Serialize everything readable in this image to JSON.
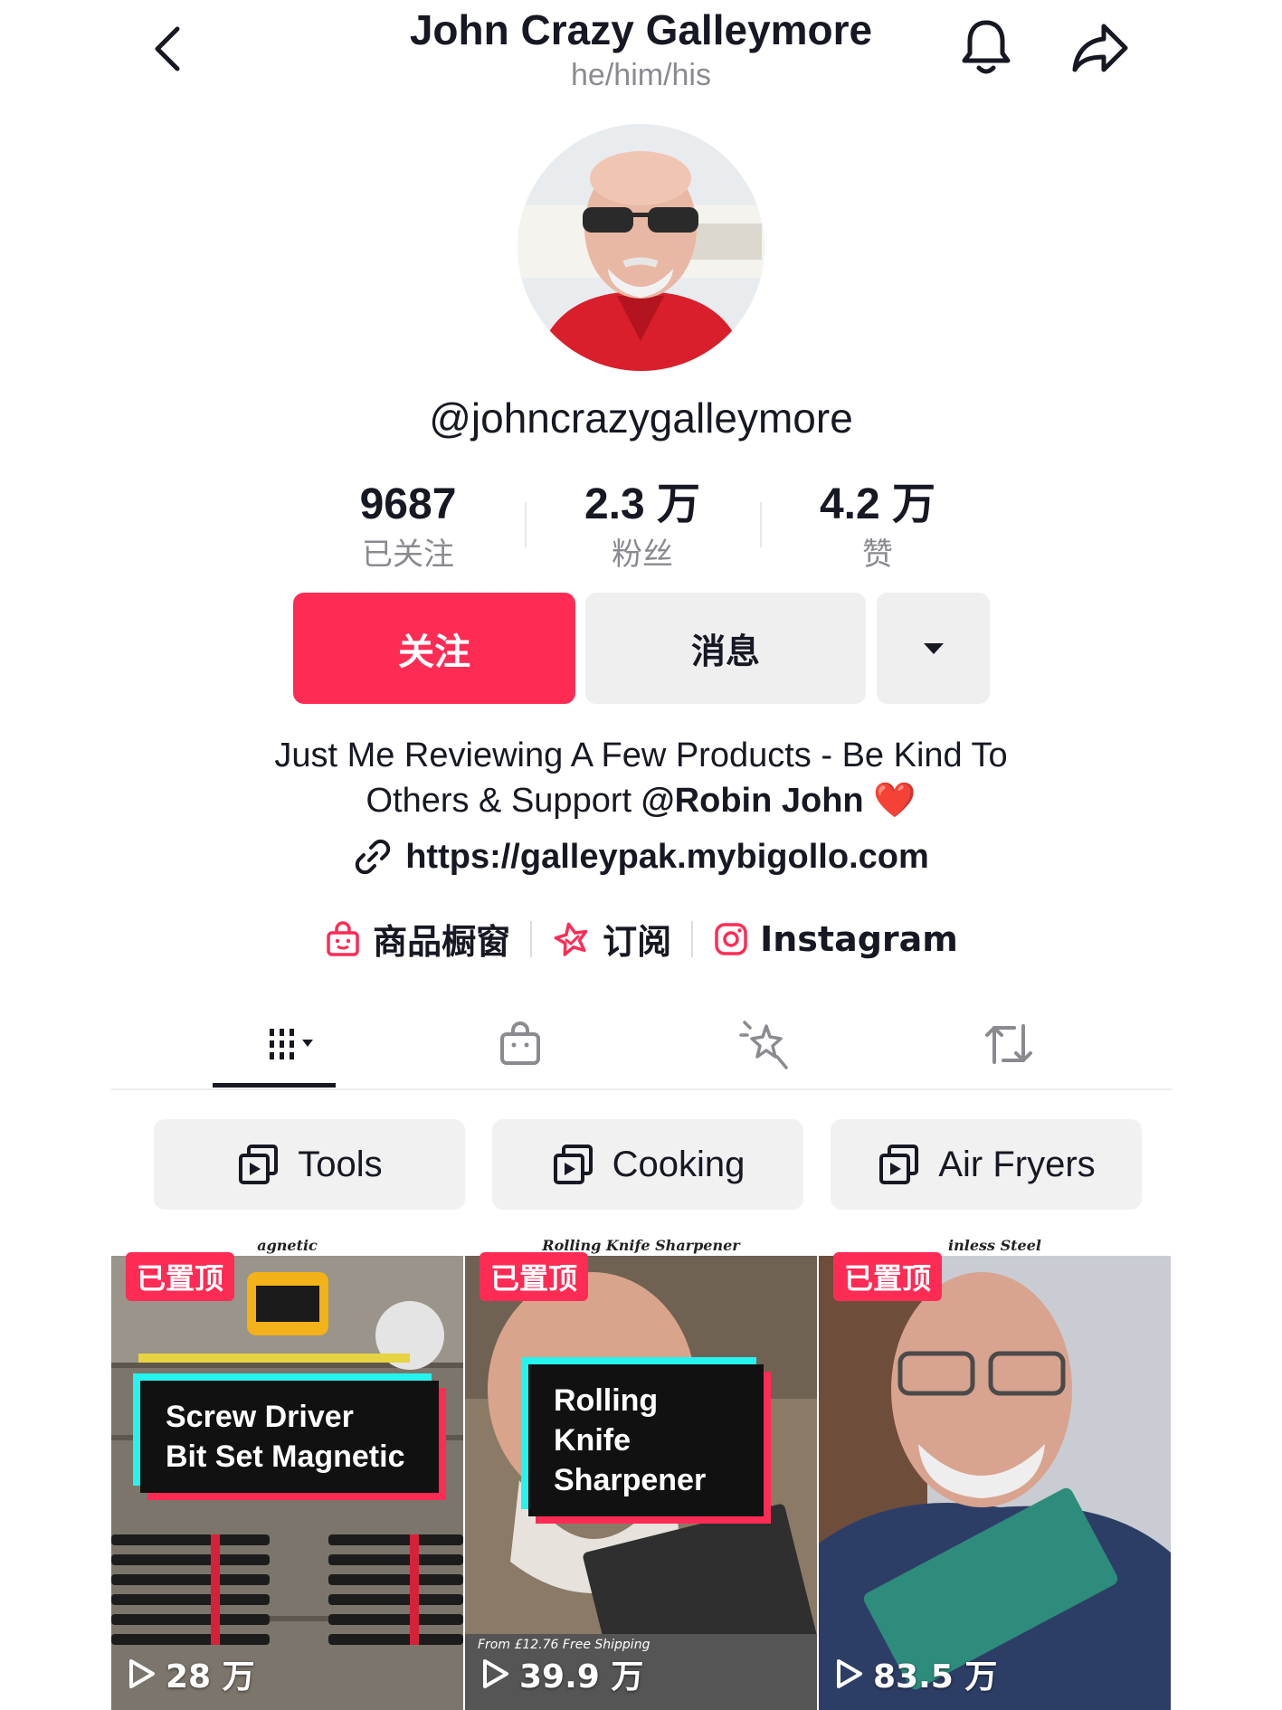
{
  "header": {
    "title": "John Crazy Galleymore",
    "pronouns": "he/him/his"
  },
  "profile": {
    "username": "@johncrazygalleymore",
    "stats": [
      {
        "value": "9687",
        "label": "已关注"
      },
      {
        "value": "2.3 万",
        "label": "粉丝"
      },
      {
        "value": "4.2 万",
        "label": "赞"
      }
    ],
    "follow_label": "关注",
    "message_label": "消息",
    "bio_line1": "Just Me Reviewing A Few Products - Be Kind To",
    "bio_line2_prefix": "Others & Support ",
    "bio_mention": "@Robin John",
    "bio_emoji": "❤️",
    "link": "https://galleypak.mybigollo.com",
    "chips": [
      {
        "label": "商品橱窗",
        "icon": "shop-bag-icon",
        "color": "#fe2c55"
      },
      {
        "label": "订阅",
        "icon": "subscription-star-icon",
        "color": "#fe2c55"
      },
      {
        "label": "Instagram",
        "icon": "instagram-icon",
        "color": "#fe2c55"
      }
    ]
  },
  "tabs": [
    {
      "name": "videos",
      "icon": "grid-icon",
      "active": true
    },
    {
      "name": "shop",
      "icon": "shopping-bag-icon"
    },
    {
      "name": "favorites",
      "icon": "sparkle-icon"
    },
    {
      "name": "reposts",
      "icon": "repost-icon"
    }
  ],
  "playlists": [
    {
      "label": "Tools",
      "icon": "playlist-icon"
    },
    {
      "label": "Cooking",
      "icon": "playlist-icon"
    },
    {
      "label": "Air Fryers",
      "icon": "playlist-icon"
    }
  ],
  "videos": [
    {
      "pinned_label": "已置顶",
      "caption_line1": "Screw Driver",
      "caption_line2": "Bit Set Magnetic",
      "plays": "28 万",
      "strip": "agnetic"
    },
    {
      "pinned_label": "已置顶",
      "caption_line1": "Rolling Knife",
      "caption_line2": "Sharpener",
      "plays": "39.9 万",
      "strip": "Rolling Knife Sharpener",
      "price_text": "From £12.76 Free Shipping"
    },
    {
      "pinned_label": "已置顶",
      "caption_line1": "",
      "caption_line2": "",
      "plays": "83.5 万",
      "strip": "inless Steel"
    }
  ],
  "colors": {
    "accent": "#fe2c55",
    "cyan": "#25f4ee",
    "text": "#161823",
    "secondary": "#8a8b91"
  }
}
